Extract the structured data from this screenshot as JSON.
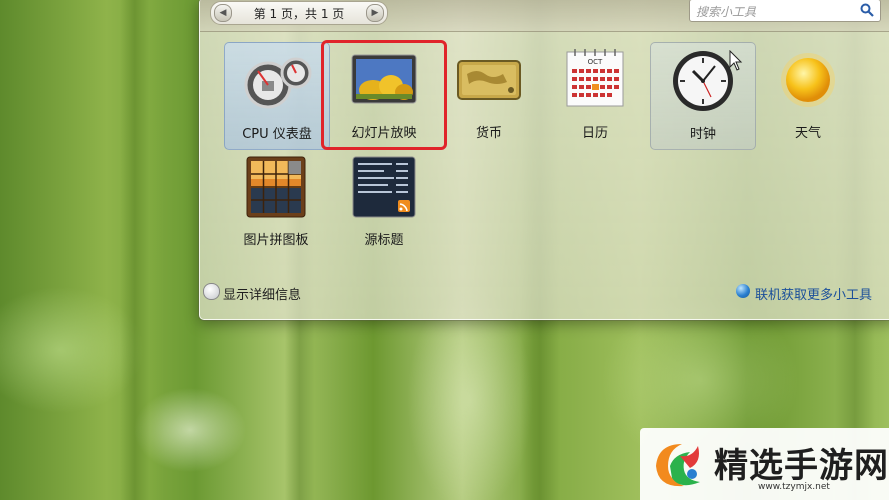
{
  "pager": {
    "prev_icon": "chevron-left-icon",
    "next_icon": "chevron-right-icon",
    "text": "第 1 页，共 1 页"
  },
  "search": {
    "placeholder": "搜索小工具",
    "icon": "search-icon"
  },
  "gadgets": [
    {
      "label": "CPU 仪表盘",
      "icon": "cpu-meter-icon",
      "state": "selected"
    },
    {
      "label": "幻灯片放映",
      "icon": "slideshow-icon",
      "state": "outlined-red"
    },
    {
      "label": "货币",
      "icon": "currency-icon",
      "state": "normal"
    },
    {
      "label": "日历",
      "icon": "calendar-icon",
      "state": "normal",
      "calendar_month": "OCT"
    },
    {
      "label": "时钟",
      "icon": "clock-icon",
      "state": "hovered"
    },
    {
      "label": "天气",
      "icon": "weather-sun-icon",
      "state": "normal"
    },
    {
      "label": "图片拼图板",
      "icon": "picture-puzzle-icon",
      "state": "normal"
    },
    {
      "label": "源标题",
      "icon": "feed-headlines-icon",
      "state": "normal"
    }
  ],
  "footer": {
    "details_label": "显示详细信息",
    "online_label": "联机获取更多小工具"
  },
  "watermark": {
    "title": "精选手游网",
    "url": "www.tzymjx.net"
  },
  "colors": {
    "highlight_box": "#e0242a",
    "link": "#1a4f9a"
  }
}
